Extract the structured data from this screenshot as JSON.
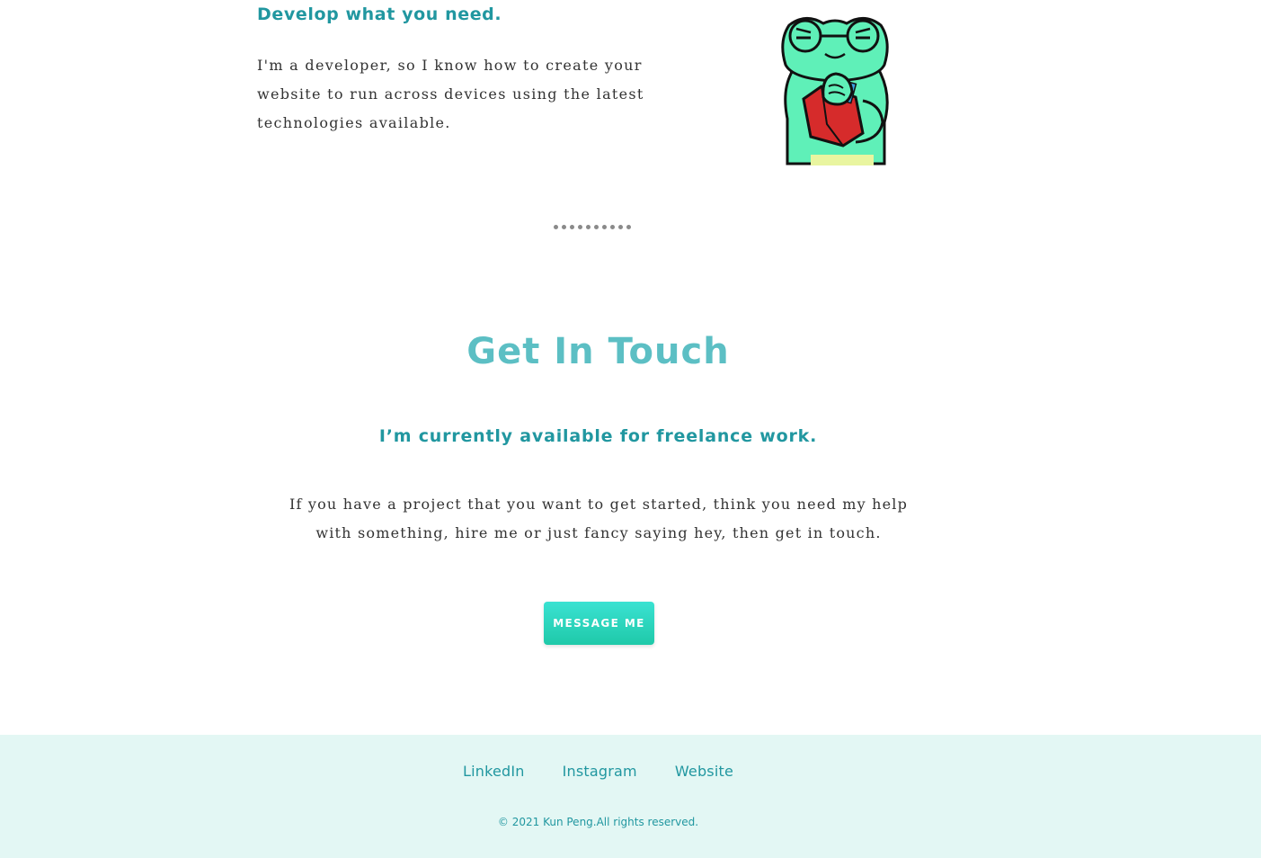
{
  "develop": {
    "heading": "Develop what you need.",
    "text": "I'm a developer, so I know how to create your website to run across devices using the latest technologies available.",
    "illustration_icon": "frog-reading-book-icon"
  },
  "divider": {
    "dot_count": 10
  },
  "contact": {
    "title": "Get In Touch",
    "subtitle": "I’m currently available for freelance work.",
    "text": "If you have a project that you want to get started, think you need my help with something, hire me or just fancy saying hey, then get in touch.",
    "button_label": "MESSAGE ME"
  },
  "footer": {
    "links": [
      "LinkedIn",
      "Instagram",
      "Website"
    ],
    "copyright": "© 2021 Kun Peng.All rights reserved."
  },
  "colors": {
    "heading_teal": "#2197a0",
    "title_teal": "#5cbfc4",
    "button_start": "#3ae2d2",
    "button_end": "#1fc9a9",
    "footer_bg": "#e3f7f4",
    "body_text": "#333333",
    "frog_green": "#5ff0b8",
    "book_red": "#d62b2b"
  }
}
